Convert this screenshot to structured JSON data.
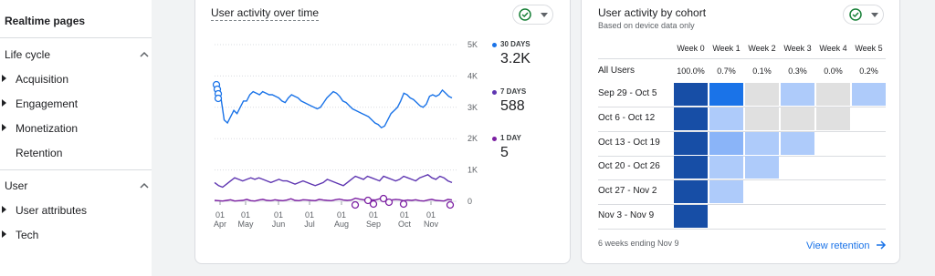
{
  "sidebar": {
    "top_item": "Realtime pages",
    "sections": [
      {
        "title": "Life cycle",
        "items": [
          "Acquisition",
          "Engagement",
          "Monetization",
          "Retention"
        ]
      },
      {
        "title": "User",
        "items": [
          "User attributes",
          "Tech"
        ]
      }
    ]
  },
  "activity": {
    "title": "User activity over time",
    "legend": [
      {
        "label": "30 DAYS",
        "value": "3.2K",
        "color": "#1a73e8"
      },
      {
        "label": "7 DAYS",
        "value": "588",
        "color": "#5e35b1"
      },
      {
        "label": "1 DAY",
        "value": "5",
        "color": "#7b1fa2"
      }
    ]
  },
  "chart_data": {
    "type": "line",
    "y_ticks": [
      "5K",
      "4K",
      "3K",
      "2K",
      "1K",
      "0"
    ],
    "ylim": [
      0,
      5000
    ],
    "x_ticks": [
      {
        "day": "01",
        "month": "Apr"
      },
      {
        "day": "01",
        "month": "May"
      },
      {
        "day": "01",
        "month": "Jun"
      },
      {
        "day": "01",
        "month": "Jul"
      },
      {
        "day": "01",
        "month": "Aug"
      },
      {
        "day": "01",
        "month": "Sep"
      },
      {
        "day": "01",
        "month": "Oct"
      },
      {
        "day": "01",
        "month": "Nov"
      }
    ],
    "series": [
      {
        "name": "30 DAYS",
        "color": "#1a73e8",
        "values": [
          3700,
          3600,
          3300,
          2600,
          2500,
          2700,
          2900,
          2800,
          3000,
          3200,
          3200,
          3400,
          3500,
          3450,
          3400,
          3500,
          3450,
          3400,
          3400,
          3350,
          3300,
          3200,
          3150,
          3300,
          3400,
          3350,
          3300,
          3200,
          3150,
          3100,
          3050,
          3000,
          2950,
          3000,
          3150,
          3300,
          3400,
          3500,
          3450,
          3350,
          3200,
          3150,
          3050,
          2950,
          2900,
          2850,
          2800,
          2750,
          2700,
          2600,
          2500,
          2450,
          2350,
          2400,
          2600,
          2800,
          2900,
          3000,
          3200,
          3450,
          3400,
          3300,
          3250,
          3150,
          3050,
          3000,
          3100,
          3350,
          3400,
          3350,
          3400,
          3550,
          3450,
          3350,
          3300
        ]
      },
      {
        "name": "7 DAYS",
        "color": "#5e35b1",
        "values": [
          600,
          500,
          450,
          550,
          650,
          750,
          700,
          650,
          700,
          750,
          700,
          750,
          700,
          650,
          600,
          650,
          700,
          650,
          650,
          600,
          550,
          600,
          650,
          600,
          550,
          500,
          550,
          600,
          700,
          650,
          600,
          550,
          500,
          600,
          700,
          800,
          750,
          700,
          800,
          750,
          700,
          650,
          800,
          750,
          700,
          650,
          700,
          800,
          750,
          700,
          650,
          750,
          800,
          850,
          750,
          700,
          800,
          750,
          650,
          600
        ]
      },
      {
        "name": "1 DAY",
        "color": "#7b1fa2",
        "values": [
          30,
          20,
          10,
          30,
          50,
          10,
          20,
          30,
          60,
          20,
          10,
          40,
          60,
          30,
          20,
          50,
          30,
          20,
          40,
          80,
          30,
          20,
          50,
          40,
          30,
          20,
          60,
          40,
          30,
          20,
          50,
          70,
          40,
          30,
          40,
          100,
          70,
          50,
          30,
          50,
          40,
          80,
          50,
          30,
          40,
          60,
          50,
          20,
          40,
          30,
          50,
          20,
          10,
          40,
          60,
          30,
          20,
          10,
          60,
          40
        ]
      }
    ],
    "markers": [
      "1 DAY anomaly circles near Aug-Sep",
      "30 DAYS anomaly circles at start of Apr"
    ]
  },
  "cohort": {
    "title": "User activity by cohort",
    "subtitle": "Based on device data only",
    "weeks": [
      "Week 0",
      "Week 1",
      "Week 2",
      "Week 3",
      "Week 4",
      "Week 5"
    ],
    "all_users_label": "All Users",
    "all_users": [
      "100.0%",
      "0.7%",
      "0.1%",
      "0.3%",
      "0.0%",
      "0.2%"
    ],
    "rows": [
      {
        "label": "Sep 29 - Oct 5",
        "colors": [
          "#174ea6",
          "#1a73e8",
          "#e0e0e0",
          "#aecbfa",
          "#e0e0e0",
          "#aecbfa"
        ]
      },
      {
        "label": "Oct 6 - Oct 12",
        "colors": [
          "#174ea6",
          "#aecbfa",
          "#e0e0e0",
          "#e0e0e0",
          "#e0e0e0"
        ]
      },
      {
        "label": "Oct 13 - Oct 19",
        "colors": [
          "#174ea6",
          "#8ab4f8",
          "#aecbfa",
          "#aecbfa"
        ]
      },
      {
        "label": "Oct 20 - Oct 26",
        "colors": [
          "#174ea6",
          "#aecbfa",
          "#aecbfa"
        ]
      },
      {
        "label": "Oct 27 - Nov 2",
        "colors": [
          "#174ea6",
          "#aecbfa"
        ]
      },
      {
        "label": "Nov 3 - Nov 9",
        "colors": [
          "#174ea6"
        ]
      }
    ],
    "footer": "6 weeks ending Nov 9",
    "link": "View retention"
  }
}
